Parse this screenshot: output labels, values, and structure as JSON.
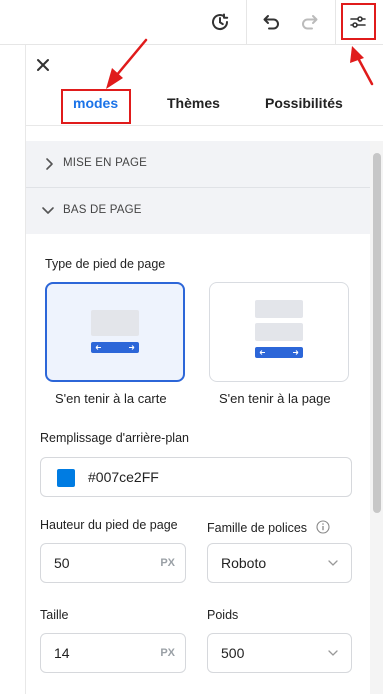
{
  "toolbar": {
    "history_icon": "history-clock-icon",
    "undo_icon": "undo-icon",
    "redo_icon": "redo-icon",
    "settings_icon": "sliders-icon"
  },
  "panel": {
    "close_icon": "close-icon",
    "tabs": [
      {
        "label": "modes",
        "active": true
      },
      {
        "label": "Thèmes",
        "active": false
      },
      {
        "label": "Possibilités",
        "active": false
      }
    ],
    "sections": [
      {
        "label": "MISE EN PAGE",
        "expanded": false
      },
      {
        "label": "BAS DE PAGE",
        "expanded": true
      }
    ],
    "footer": {
      "type_label": "Type de pied de page",
      "options": [
        {
          "caption": "S'en tenir à la carte",
          "selected": true
        },
        {
          "caption": "S'en tenir à la page",
          "selected": false
        }
      ],
      "bg_label": "Remplissage d'arrière-plan",
      "bg_value": "#007ce2FF",
      "bg_color": "#007ce2",
      "height_label": "Hauteur du pied de page",
      "height_value": "50",
      "height_unit": "PX",
      "font_family_label": "Famille de polices",
      "font_family_value": "Roboto",
      "size_label": "Taille",
      "size_value": "14",
      "size_unit": "PX",
      "weight_label": "Poids",
      "weight_value": "500"
    }
  },
  "colors": {
    "accent": "#1a73e8",
    "annotation_red": "#e01b1b",
    "footer_bar_blue": "#2c66d8"
  }
}
